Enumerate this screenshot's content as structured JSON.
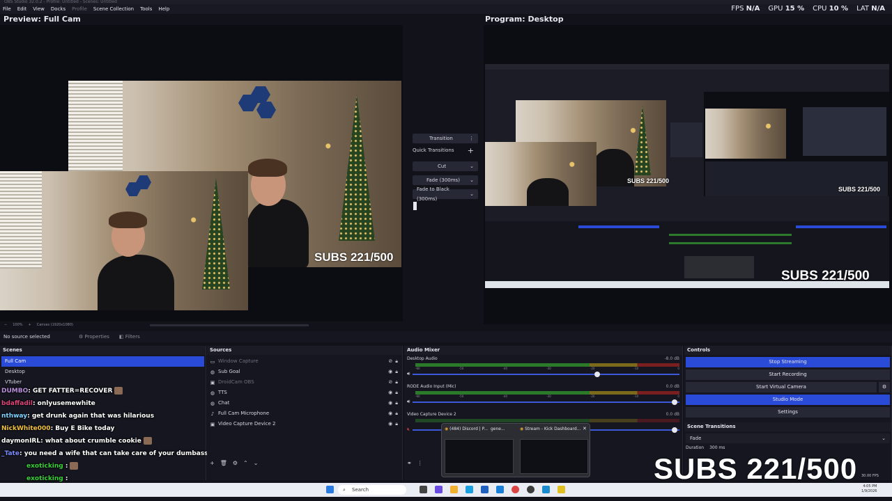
{
  "window": {
    "title": "OBS Studio 32.0.2 - Profile: Untitled - Scenes: Untitled"
  },
  "menu": [
    "File",
    "Edit",
    "View",
    "Docks",
    "Profile",
    "Scene Collection",
    "Tools",
    "Help"
  ],
  "stats": {
    "fps_label": "FPS",
    "fps_value": "N/A",
    "gpu_label": "GPU",
    "gpu_value": "15 %",
    "cpu_label": "CPU",
    "cpu_value": "10 %",
    "lat_label": "LAT",
    "lat_value": "N/A"
  },
  "preview": {
    "label": "Preview: Full Cam",
    "zoom": "100%",
    "canvas": "Canvas (1920x1080)"
  },
  "program": {
    "label": "Program: Desktop"
  },
  "overlay": {
    "subs": "SUBS 221/500"
  },
  "transition_panel": {
    "transition_label": "Transition",
    "quick_label": "Quick Transitions",
    "items": [
      "Cut",
      "Fade (300ms)",
      "Fade to Black (300ms)"
    ]
  },
  "source_bar": {
    "status": "No source selected",
    "properties": "Properties",
    "filters": "Filters"
  },
  "scenes": {
    "title": "Scenes",
    "items": [
      "Full Cam",
      "Desktop",
      "VTuber"
    ]
  },
  "sources": {
    "title": "Sources",
    "items": [
      "Window Capture",
      "Sub Goal",
      "DroidCam OBS",
      "TTS",
      "Chat",
      "Full Cam Microphone",
      "Video Capture Device 2"
    ]
  },
  "chat": [
    {
      "user": "DUMBO",
      "msg": ": GET FATTER=RECOVER",
      "color": "#b98fdc"
    },
    {
      "user": "bdaffadil",
      "msg": ": onlyusemewhite",
      "color": "#e0457b"
    },
    {
      "user": "nthway",
      "msg": ": get drunk again that was hilarious",
      "color": "#7fd3ff"
    },
    {
      "user": "NickWhite000",
      "msg": ": Buy E Bike today",
      "color": "#f0c040"
    },
    {
      "user": "daymonIRL",
      "msg": ": what about crumble cookie",
      "color": "#ffffff"
    },
    {
      "user": "_Tate",
      "msg": ": you need a wife that can take care of your dumbass",
      "color": "#7a8cff"
    },
    {
      "user": "exoticking",
      "msg": ":",
      "color": "#3ad23a"
    },
    {
      "user": "exoticking",
      "msg": ":",
      "color": "#3ad23a"
    },
    {
      "user": "exoticking",
      "msg": "",
      "color": "#3ad23a"
    }
  ],
  "mixer": {
    "title": "Audio Mixer",
    "channels": [
      {
        "name": "Desktop Audio",
        "db": "-8.0 dB"
      },
      {
        "name": "RODE Audio Input (Mic)",
        "db": "0.0 dB"
      },
      {
        "name": "Video Capture Device 2",
        "db": "0.0 dB"
      }
    ],
    "scale": [
      "-60",
      "-55",
      "-50",
      "-45",
      "-40",
      "-35",
      "-30",
      "-25",
      "-20",
      "-15",
      "-10",
      "-5",
      "0"
    ]
  },
  "controls": {
    "title": "Controls",
    "buttons": [
      "Stop Streaming",
      "Start Recording",
      "Start Virtual Camera",
      "Studio Mode",
      "Settings"
    ]
  },
  "scene_transitions": {
    "title": "Scene Transitions",
    "value": "Fade",
    "duration_label": "Duration",
    "duration_value": "300 ms"
  },
  "status_bar": {
    "fps": "30.00 FPS"
  },
  "taskbar_popup": {
    "discord": "(484) Discord | P...",
    "gene": "gene...",
    "stream": "Stream - Kick Dashboard..."
  },
  "taskbar": {
    "search": "Search",
    "time": "4:05 PM",
    "date": "1/9/2026"
  },
  "colors": {
    "accent": "#2a4bd7",
    "panel": "#15161f",
    "bg": "#0c0d13"
  }
}
